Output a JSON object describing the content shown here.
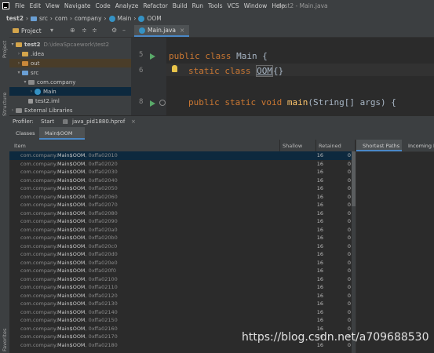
{
  "menubar": {
    "items": [
      "File",
      "Edit",
      "View",
      "Navigate",
      "Code",
      "Analyze",
      "Refactor",
      "Build",
      "Run",
      "Tools",
      "VCS",
      "Window",
      "Help"
    ],
    "window_title": "test2 - Main.java"
  },
  "breadcrumb": [
    "test2",
    "src",
    "com",
    "company",
    "Main",
    "OOM"
  ],
  "stripe": {
    "project": "Project",
    "structure": "Structure",
    "favorites": "Favorites"
  },
  "project": {
    "title": "Project",
    "root_name": "test2",
    "root_path": "D:\\ideaSpcaework\\test2",
    "idea": ".idea",
    "out": "out",
    "src": "src",
    "package": "com.company",
    "main": "Main",
    "iml": "test2.iml",
    "external": "External Libraries"
  },
  "editor": {
    "tab": "Main.java",
    "lines": [
      {
        "num": "5",
        "kw": "public class ",
        "name": "Main",
        "rest": " {"
      },
      {
        "num": "6",
        "kw": "static class ",
        "name": "OOM",
        "rest": "{}"
      },
      {
        "num": "8",
        "kw": "public static void ",
        "name": "main",
        "rest": "(String[] args) {"
      }
    ]
  },
  "profiler": {
    "label": "Profiler:",
    "start": "Start",
    "file": "java_pid1880.hprof",
    "tabs": [
      "Classes",
      "Main$OOM"
    ]
  },
  "table": {
    "headers": {
      "item": "Item",
      "shallow": "Shallow",
      "retained": "Retained"
    },
    "prefix": "com.company.",
    "class_name": "Main$OOM",
    "rows": [
      {
        "addr": "0xffa02010",
        "shallow": "16",
        "retained": "0"
      },
      {
        "addr": "0xffa02020",
        "shallow": "16",
        "retained": "0"
      },
      {
        "addr": "0xffa02030",
        "shallow": "16",
        "retained": "0"
      },
      {
        "addr": "0xffa02040",
        "shallow": "16",
        "retained": "0"
      },
      {
        "addr": "0xffa02050",
        "shallow": "16",
        "retained": "0"
      },
      {
        "addr": "0xffa02060",
        "shallow": "16",
        "retained": "0"
      },
      {
        "addr": "0xffa02070",
        "shallow": "16",
        "retained": "0"
      },
      {
        "addr": "0xffa02080",
        "shallow": "16",
        "retained": "0"
      },
      {
        "addr": "0xffa02090",
        "shallow": "16",
        "retained": "0"
      },
      {
        "addr": "0xffa020a0",
        "shallow": "16",
        "retained": "0"
      },
      {
        "addr": "0xffa020b0",
        "shallow": "16",
        "retained": "0"
      },
      {
        "addr": "0xffa020c0",
        "shallow": "16",
        "retained": "0"
      },
      {
        "addr": "0xffa020d0",
        "shallow": "16",
        "retained": "0"
      },
      {
        "addr": "0xffa020e0",
        "shallow": "16",
        "retained": "0"
      },
      {
        "addr": "0xffa020f0",
        "shallow": "16",
        "retained": "0"
      },
      {
        "addr": "0xffa02100",
        "shallow": "16",
        "retained": "0"
      },
      {
        "addr": "0xffa02110",
        "shallow": "16",
        "retained": "0"
      },
      {
        "addr": "0xffa02120",
        "shallow": "16",
        "retained": "0"
      },
      {
        "addr": "0xffa02130",
        "shallow": "16",
        "retained": "0"
      },
      {
        "addr": "0xffa02140",
        "shallow": "16",
        "retained": "0"
      },
      {
        "addr": "0xffa02150",
        "shallow": "16",
        "retained": "0"
      },
      {
        "addr": "0xffa02160",
        "shallow": "16",
        "retained": "0"
      },
      {
        "addr": "0xffa02170",
        "shallow": "16",
        "retained": "0"
      },
      {
        "addr": "0xffa02180",
        "shallow": "16",
        "retained": "0"
      }
    ]
  },
  "right_tabs": [
    "Shortest Paths",
    "Incoming R"
  ],
  "watermark": "https://blog.csdn.net/a709688530",
  "colors": {
    "background": "#2b2b2b",
    "panel": "#3c3f41",
    "selection": "#0d293e",
    "keyword": "#cc7832",
    "accent": "#4a88c7"
  }
}
